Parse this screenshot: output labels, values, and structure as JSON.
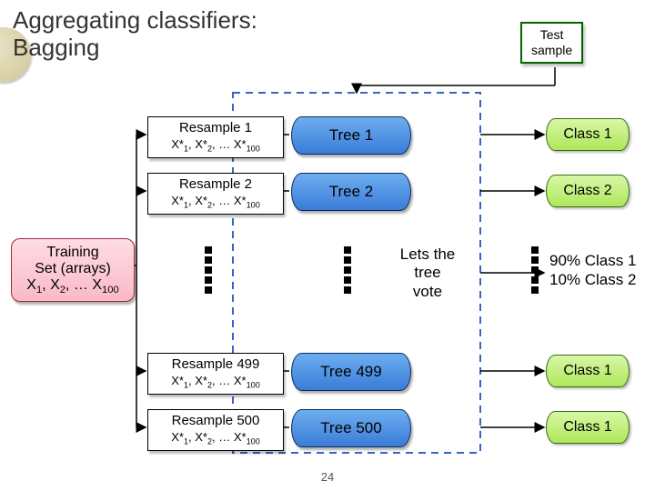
{
  "title_line1": "Aggregating classifiers:",
  "title_line2": "Bagging",
  "test_sample_l1": "Test",
  "test_sample_l2": "sample",
  "training_l1": "Training",
  "training_l2": "Set (arrays)",
  "training_l3_prefix": "X",
  "training_l3_mid": ", X",
  "training_l3_tail": ", … X",
  "sub1": "1",
  "sub2": "2",
  "sub100": "100",
  "resamples": [
    {
      "title": "Resample 1",
      "tree": "Tree 1",
      "cls": "Class 1"
    },
    {
      "title": "Resample 2",
      "tree": "Tree 2",
      "cls": "Class 2"
    },
    {
      "title": "Resample 499",
      "tree": "Tree 499",
      "cls": "Class 1"
    },
    {
      "title": "Resample 500",
      "tree": "Tree 500",
      "cls": "Class 1"
    }
  ],
  "resample_line2_prefix": "X*",
  "resample_line2_mid": ", X*",
  "resample_line2_tail": ", … X*",
  "vote_l1": "Lets the",
  "vote_l2": "tree",
  "vote_l3": "vote",
  "result_l1": "90% Class 1",
  "result_l2": "10% Class 2",
  "slide_number": "24"
}
